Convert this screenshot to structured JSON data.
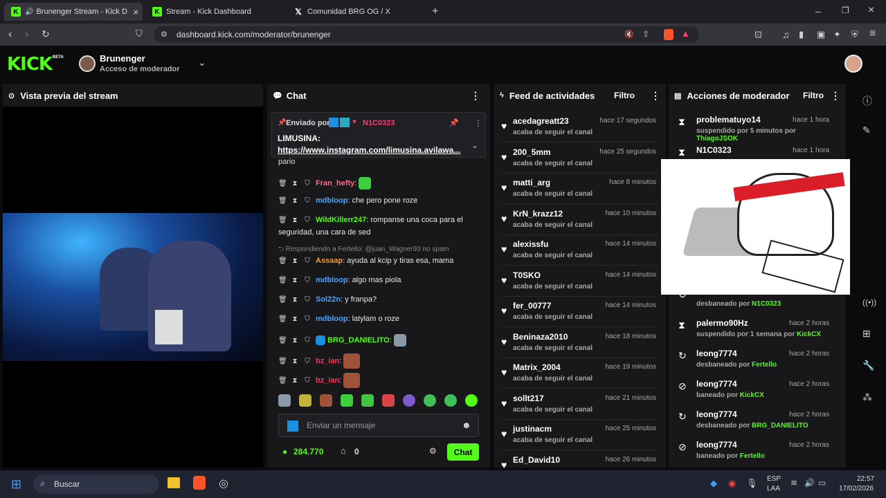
{
  "browser": {
    "tabs": [
      {
        "label": "Brunenger Stream - Kick Dash",
        "icon": "kick-icon"
      },
      {
        "label": "Stream - Kick Dashboard",
        "icon": "kick-icon"
      },
      {
        "label": "Comunidad BRG OG / X",
        "icon": "x-icon"
      }
    ],
    "url": "dashboard.kick.com/moderator/brunenger"
  },
  "header": {
    "logo": "KICK",
    "logo_badge": "BETA",
    "channel": "Brunenger",
    "role": "Acceso de moderador"
  },
  "preview": {
    "title": "Vista previa del stream"
  },
  "chat": {
    "title": "Chat",
    "pinned_label": "Enviado por",
    "pinned_user": "N1C0323",
    "pinned_text": "LIMUSINA:",
    "pinned_link": "https://www.instagram.com/limusina.avilawa...",
    "partial_text": "pario",
    "reply_note": "Respondiendo a Fertello: @juan_Wagner93 no spam",
    "messages": [
      {
        "user": "Fran_hefty",
        "color": "#ff6b8a",
        "text": ""
      },
      {
        "user": "mdbloop",
        "color": "#4aa3ff",
        "text": "che pero pone roze"
      },
      {
        "user": "WildKillerr247",
        "color": "#53fc18",
        "text": "rompanse una coca para el"
      },
      {
        "user": "Assaap",
        "color": "#ff9a1f",
        "text": "ayuda al kcip y tiras esa, mama"
      },
      {
        "user": "mdbloop",
        "color": "#4aa3ff",
        "text": "algo mas piola"
      },
      {
        "user": "Sol22n",
        "color": "#4aa3ff",
        "text": "y franpa?"
      },
      {
        "user": "mdbloop",
        "color": "#4aa3ff",
        "text": "latylam o roze"
      },
      {
        "user": "BRG_DANIELITO",
        "color": "#53fc18",
        "text": ""
      },
      {
        "user": "bz_ian",
        "color": "#ff3355",
        "text": ""
      },
      {
        "user": "bz_ian",
        "color": "#ff3355",
        "text": ""
      }
    ],
    "wrap_text": "seguridad, una cara de sed",
    "input_placeholder": "Enviar un mensaje",
    "points": "284.770",
    "store_count": "0",
    "send_label": "Chat"
  },
  "feed": {
    "title": "Feed de actividades",
    "filter": "Filtro",
    "items": [
      {
        "name": "acedagreatt23",
        "time": "hace 17 segundos",
        "action": "acaba de seguir el canal"
      },
      {
        "name": "200_5mm",
        "time": "hace 25 segundos",
        "action": "acaba de seguir el canal"
      },
      {
        "name": "matti_arg",
        "time": "hace 8 minutos",
        "action": "acaba de seguir el canal"
      },
      {
        "name": "KrN_krazz12",
        "time": "hace 10 minutos",
        "action": "acaba de seguir el canal"
      },
      {
        "name": "alexissfu",
        "time": "hace 14 minutos",
        "action": "acaba de seguir el canal"
      },
      {
        "name": "T0SKO",
        "time": "hace 14 minutos",
        "action": "acaba de seguir el canal"
      },
      {
        "name": "fer_00777",
        "time": "hace 14 minutos",
        "action": "acaba de seguir el canal"
      },
      {
        "name": "Beninaza2010",
        "time": "hace 18 minutos",
        "action": "acaba de seguir el canal"
      },
      {
        "name": "Matrix_2004",
        "time": "hace 19 minutos",
        "action": "acaba de seguir el canal"
      },
      {
        "name": "sollt217",
        "time": "hace 21 minutos",
        "action": "acaba de seguir el canal"
      },
      {
        "name": "justinacm",
        "time": "hace 25 minutos",
        "action": "acaba de seguir el canal"
      },
      {
        "name": "Ed_David10",
        "time": "hace 26 minutos",
        "action": ""
      }
    ]
  },
  "modactions": {
    "title": "Acciones de moderador",
    "filter": "Filtro",
    "items": [
      {
        "name": "problematuyo14",
        "time": "hace 1 hora",
        "action": "suspendido por 5 minutos por",
        "by": "ThiagoJSOK",
        "icon": "hourglass-icon"
      },
      {
        "name": "N1C0323",
        "time": "hace 1 hora",
        "action": "",
        "by": "",
        "icon": "hourglass-icon"
      },
      {
        "name": "",
        "time": "",
        "action": "desbaneado por",
        "by": "N1C0323",
        "icon": "unban-icon"
      },
      {
        "name": "palermo90Hz",
        "time": "hace 2 horas",
        "action": "suspendido por 1 semana por",
        "by": "KickCX",
        "icon": "hourglass-icon"
      },
      {
        "name": "leong7774",
        "time": "hace 2 horas",
        "action": "desbaneado por",
        "by": "Fertello",
        "icon": "unban-icon"
      },
      {
        "name": "leong7774",
        "time": "hace 2 horas",
        "action": "baneado por",
        "by": "KickCX",
        "icon": "ban-icon"
      },
      {
        "name": "leong7774",
        "time": "hace 2 horas",
        "action": "desbaneado por",
        "by": "BRG_DANIELITO",
        "icon": "unban-icon"
      },
      {
        "name": "leong7774",
        "time": "hace 2 horas",
        "action": "baneado por",
        "by": "Fertello",
        "icon": "ban-icon"
      }
    ]
  },
  "taskbar": {
    "search": "Buscar",
    "lang1": "ESP",
    "lang2": "LAA",
    "time": "22:57",
    "date": "17/02/2026"
  }
}
